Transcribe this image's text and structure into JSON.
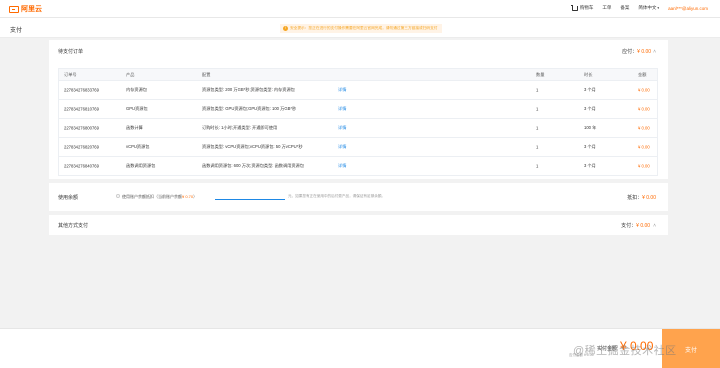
{
  "brand": {
    "logo_text": "阿里云"
  },
  "topnav": {
    "cart": "购物车",
    "orders": "工单",
    "docs": "备案",
    "lang": "简体中文",
    "account": "aanl***@aliyun.com"
  },
  "page": {
    "title": "支付"
  },
  "notice": {
    "text": "安全提示：您正在进行的支付操作需要在阿里云官网完成，请勿通过第三方链接或扫码支付"
  },
  "orders": {
    "heading": "待支付订单",
    "total_label": "应付：",
    "total_amount": "¥ 0.00",
    "columns": {
      "id": "订单号",
      "product": "产品",
      "config": "配置",
      "qty": "数量",
      "duration": "时长",
      "amount": "金额"
    },
    "rows": [
      {
        "id": "227834276833769",
        "product": "内存资源包",
        "config": "资源包类型: 200 万GB*秒;资源包类型: 内存资源包",
        "detail": "详情",
        "qty": "1",
        "duration": "3 个月",
        "amount": "¥ 0.00"
      },
      {
        "id": "227834276810769",
        "product": "GPU资源包",
        "config": "资源包类型: GPU资源包;GPU资源包: 100 万GB*秒",
        "detail": "详情",
        "qty": "1",
        "duration": "3 个月",
        "amount": "¥ 0.00"
      },
      {
        "id": "227834276800769",
        "product": "函数计算",
        "config": "订购时长: 1小时;开通类型: 开通即可使用",
        "detail": "详情",
        "qty": "1",
        "duration": "100 年",
        "amount": "¥ 0.00"
      },
      {
        "id": "227834276820769",
        "product": "vCPU资源包",
        "config": "资源包类型: vCPU资源包;vCPU资源包: 50 万vCPU*秒",
        "detail": "详情",
        "qty": "1",
        "duration": "3 个月",
        "amount": "¥ 0.00"
      },
      {
        "id": "227834276840769",
        "product": "函数调用资源包",
        "config": "函数调用资源包: 600 万次;资源包类型: 函数调用资源包",
        "detail": "详情",
        "qty": "1",
        "duration": "3 个月",
        "amount": "¥ 0.00"
      }
    ]
  },
  "balance": {
    "heading": "使用余额",
    "option_text": "使用账户余额抵扣（当前账户余额",
    "balance_value": "¥ 0.70",
    "option_suffix": "）",
    "input_value": "",
    "hint": "元，如果您有正在使用中的后付费产品，请保证有足够余额。",
    "deduct_label": "抵扣：",
    "deduct_amount": "¥ 0.00"
  },
  "other": {
    "heading": "其他方式支付",
    "pay_label": "支付：",
    "pay_amount": "¥ 0.00"
  },
  "footer": {
    "pay_label": "实付金额",
    "pay_amount": "¥ 0.00",
    "small": "应付金额 ¥ 0.00",
    "pay_button": "支付",
    "watermark": "@稀土掘金技术社区"
  },
  "colors": {
    "accent": "#ff6a00",
    "link": "#1e88e5",
    "button": "#ffa34d"
  }
}
